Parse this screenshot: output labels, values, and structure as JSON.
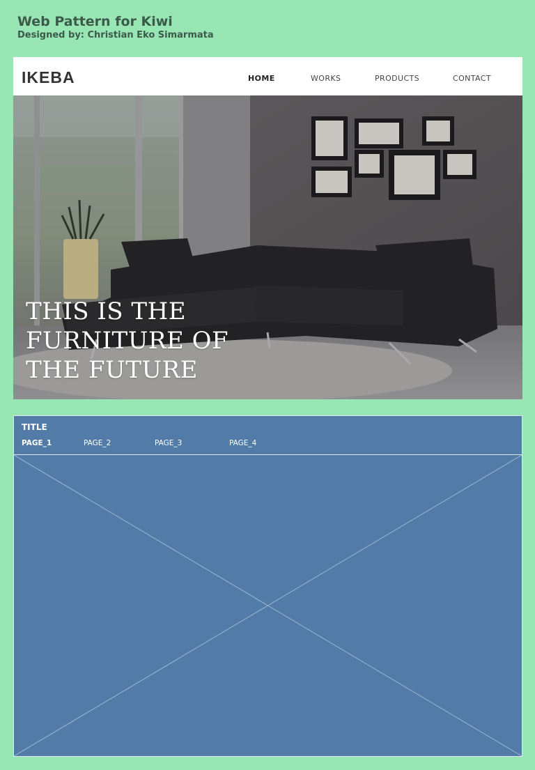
{
  "page": {
    "title": "Web Pattern for Kiwi",
    "subtitle": "Designed by: Christian Eko Simarmata"
  },
  "site": {
    "logo": "IKEBA",
    "nav": [
      {
        "label": "HOME",
        "active": true
      },
      {
        "label": "WORKS",
        "active": false
      },
      {
        "label": "PRODUCTS",
        "active": false
      },
      {
        "label": "CONTACT",
        "active": false
      }
    ],
    "hero_text": "THIS IS THE\nFURNITURE OF\nTHE FUTURE"
  },
  "pattern": {
    "title": "TITLE",
    "tabs": [
      {
        "label": "PAGE_1",
        "active": true
      },
      {
        "label": "PAGE_2",
        "active": false
      },
      {
        "label": "PAGE_3",
        "active": false
      },
      {
        "label": "PAGE_4",
        "active": false
      }
    ]
  },
  "colors": {
    "background": "#97e6b4",
    "heading": "#3c5a49",
    "pattern_bg": "#527ba8",
    "pattern_line": "#dfe7ef"
  }
}
